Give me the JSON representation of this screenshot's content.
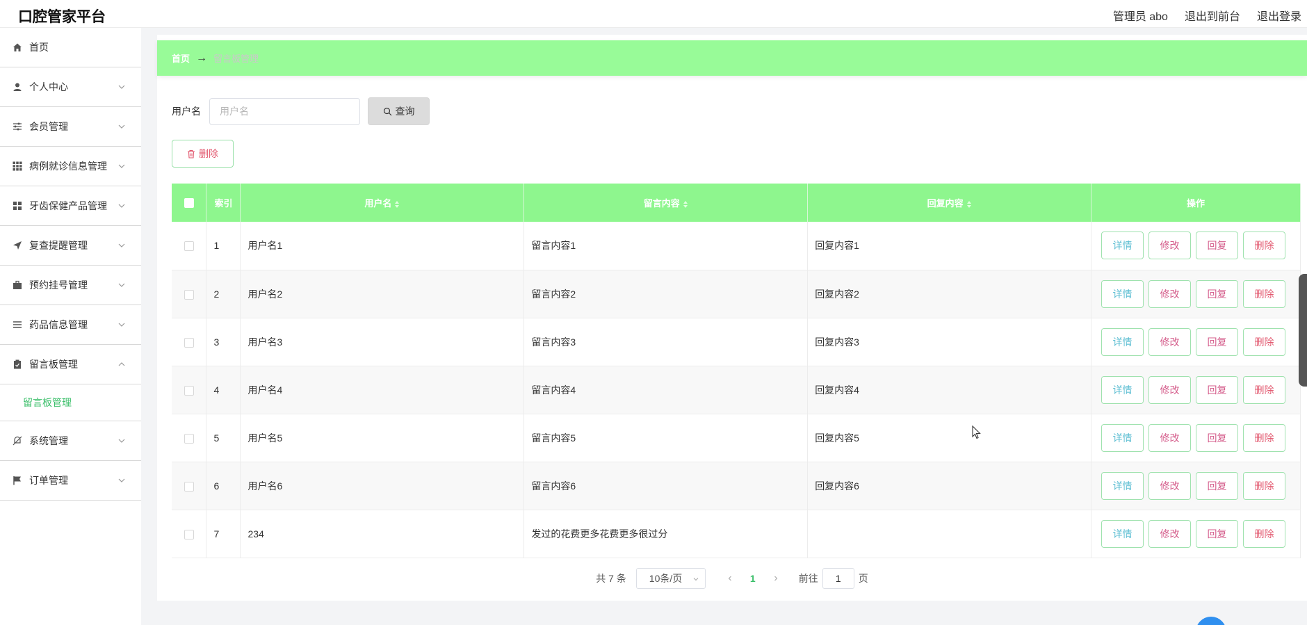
{
  "app": {
    "title": "口腔管家平台",
    "admin_label": "管理员 abo",
    "front_label": "退出到前台",
    "logout_label": "退出登录"
  },
  "sidebar": {
    "items": [
      {
        "label": "首页",
        "icon": "home-icon"
      },
      {
        "label": "个人中心",
        "icon": "user-icon"
      },
      {
        "label": "会员管理",
        "icon": "sliders-icon"
      },
      {
        "label": "病例就诊信息管理",
        "icon": "grid-icon"
      },
      {
        "label": "牙齿保健产品管理",
        "icon": "apps-icon"
      },
      {
        "label": "复查提醒管理",
        "icon": "send-icon"
      },
      {
        "label": "预约挂号管理",
        "icon": "briefcase-icon"
      },
      {
        "label": "药品信息管理",
        "icon": "list-icon"
      },
      {
        "label": "留言板管理",
        "icon": "clipboard-icon"
      },
      {
        "label": "系统管理",
        "icon": "bell-off-icon"
      },
      {
        "label": "订单管理",
        "icon": "flag-icon"
      }
    ],
    "sub_item": "留言板管理"
  },
  "breadcrumb": {
    "home": "首页",
    "current": "留言板管理"
  },
  "search": {
    "label": "用户名",
    "placeholder": "用户名",
    "value": "",
    "query_label": "查询"
  },
  "toolbar": {
    "delete_label": "删除"
  },
  "table": {
    "headers": {
      "index": "索引",
      "user": "用户名",
      "message": "留言内容",
      "reply": "回复内容",
      "ops": "操作"
    },
    "rows": [
      {
        "index": "1",
        "user": "用户名1",
        "message": "留言内容1",
        "reply": "回复内容1"
      },
      {
        "index": "2",
        "user": "用户名2",
        "message": "留言内容2",
        "reply": "回复内容2"
      },
      {
        "index": "3",
        "user": "用户名3",
        "message": "留言内容3",
        "reply": "回复内容3"
      },
      {
        "index": "4",
        "user": "用户名4",
        "message": "留言内容4",
        "reply": "回复内容4"
      },
      {
        "index": "5",
        "user": "用户名5",
        "message": "留言内容5",
        "reply": "回复内容5"
      },
      {
        "index": "6",
        "user": "用户名6",
        "message": "留言内容6",
        "reply": "回复内容6"
      },
      {
        "index": "7",
        "user": "234",
        "message": "发过的花费更多花费更多很过分",
        "reply": ""
      }
    ],
    "row_buttons": {
      "detail": "详情",
      "edit": "修改",
      "reply": "回复",
      "delete": "删除"
    }
  },
  "pagination": {
    "total": "共 7 条",
    "page_size": "10条/页",
    "current_page": "1",
    "goto_label": "前往",
    "goto_value": "1",
    "page_suffix": "页"
  },
  "colors": {
    "accent_green": "#98fb98",
    "header_green": "#8ef68e",
    "active_text": "#3bbf6a",
    "danger": "#e2576e"
  }
}
